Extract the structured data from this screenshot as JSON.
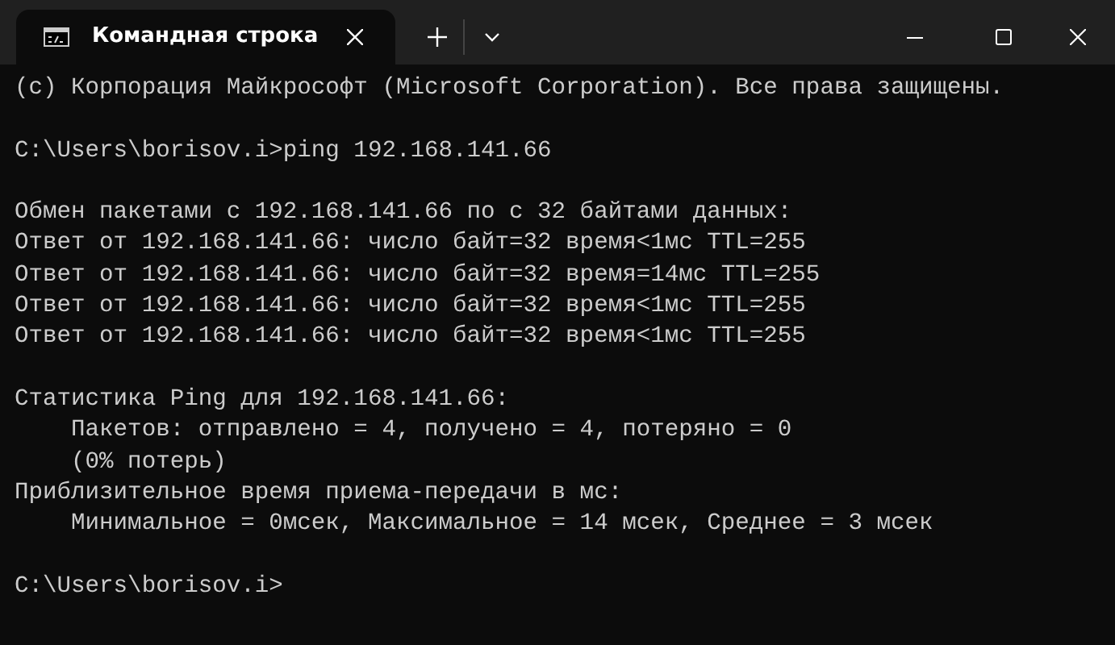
{
  "tabs": [
    {
      "title": "Командная строка",
      "selected": true
    }
  ],
  "terminal": {
    "blocks": [
      [
        "(c) Корпорация Майкрософт (Microsoft Corporation). Все права защищены."
      ],
      [
        "C:\\Users\\borisov.i>ping 192.168.141.66"
      ],
      [
        "Обмен пакетами с 192.168.141.66 по с 32 байтами данных:",
        "Ответ от 192.168.141.66: число байт=32 время<1мс TTL=255",
        "Ответ от 192.168.141.66: число байт=32 время=14мс TTL=255",
        "Ответ от 192.168.141.66: число байт=32 время<1мс TTL=255",
        "Ответ от 192.168.141.66: число байт=32 время<1мс TTL=255"
      ],
      [
        "Статистика Ping для 192.168.141.66:",
        "    Пакетов: отправлено = 4, получено = 4, потеряно = 0",
        "    (0% потерь)",
        "Приблизительное время приема-передачи в мс:",
        "    Минимальное = 0мсек, Максимальное = 14 мсек, Среднее = 3 мсек"
      ],
      [
        "C:\\Users\\borisov.i>"
      ]
    ]
  }
}
